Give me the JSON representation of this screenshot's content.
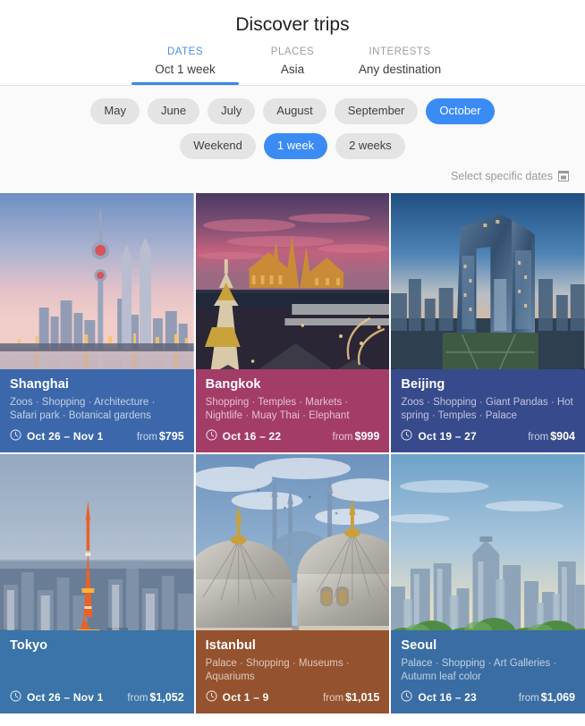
{
  "header": {
    "title": "Discover trips",
    "tabs": [
      {
        "category": "DATES",
        "value": "Oct 1 week",
        "active": true
      },
      {
        "category": "PLACES",
        "value": "Asia",
        "active": false
      },
      {
        "category": "INTERESTS",
        "value": "Any destination",
        "active": false
      }
    ]
  },
  "filters": {
    "months": [
      {
        "label": "May",
        "selected": false
      },
      {
        "label": "June",
        "selected": false
      },
      {
        "label": "July",
        "selected": false
      },
      {
        "label": "August",
        "selected": false
      },
      {
        "label": "September",
        "selected": false
      },
      {
        "label": "October",
        "selected": true
      }
    ],
    "durations": [
      {
        "label": "Weekend",
        "selected": false
      },
      {
        "label": "1 week",
        "selected": true
      },
      {
        "label": "2 weeks",
        "selected": false
      }
    ],
    "specific_dates_label": "Select specific dates",
    "calendar_icon": "calendar-icon"
  },
  "colors": {
    "accent": "#3b8bf5",
    "tab_category_active": "#4a90e8",
    "chip_bg": "#e4e4e4",
    "panel_shanghai": "#3c68ab",
    "panel_bangkok": "#a43c68",
    "panel_beijing": "#374a8c",
    "panel_tokyo": "#3b74a8",
    "panel_istanbul": "#95522f",
    "panel_seoul": "#3a6da3"
  },
  "cards": [
    {
      "city": "Shanghai",
      "tags": "Zoos · Shopping · Architecture · Safari park · Botanical gardens",
      "dates": "Oct 26 – Nov 1",
      "price_prefix": "from",
      "price": "$795",
      "panel_color": "#3c68ab",
      "photo": "shanghai-skyline-dusk"
    },
    {
      "city": "Bangkok",
      "tags": "Shopping · Temples · Markets · Nightlife · Muay Thai · Elephant",
      "dates": "Oct 16 – 22",
      "price_prefix": "from",
      "price": "$999",
      "panel_color": "#a43c68",
      "photo": "bangkok-grand-palace-sunset"
    },
    {
      "city": "Beijing",
      "tags": "Zoos · Shopping · Giant Pandas · Hot spring · Temples · Palace",
      "dates": "Oct 19 – 27",
      "price_prefix": "from",
      "price": "$904",
      "panel_color": "#374a8c",
      "photo": "beijing-cctv-tower"
    },
    {
      "city": "Tokyo",
      "tags": "",
      "dates": "Oct 26 – Nov 1",
      "price_prefix": "from",
      "price": "$1,052",
      "panel_color": "#3b74a8",
      "photo": "tokyo-tower-cityscape"
    },
    {
      "city": "Istanbul",
      "tags": "Palace · Shopping · Museums · Aquariums",
      "dates": "Oct 1 – 9",
      "price_prefix": "from",
      "price": "$1,015",
      "panel_color": "#95522f",
      "photo": "istanbul-domes-minarets"
    },
    {
      "city": "Seoul",
      "tags": "Palace · Shopping · Art Galleries · Autumn leaf color",
      "dates": "Oct 16 – 23",
      "price_prefix": "from",
      "price": "$1,069",
      "panel_color": "#3a6da3",
      "photo": "seoul-skyline-river"
    }
  ]
}
